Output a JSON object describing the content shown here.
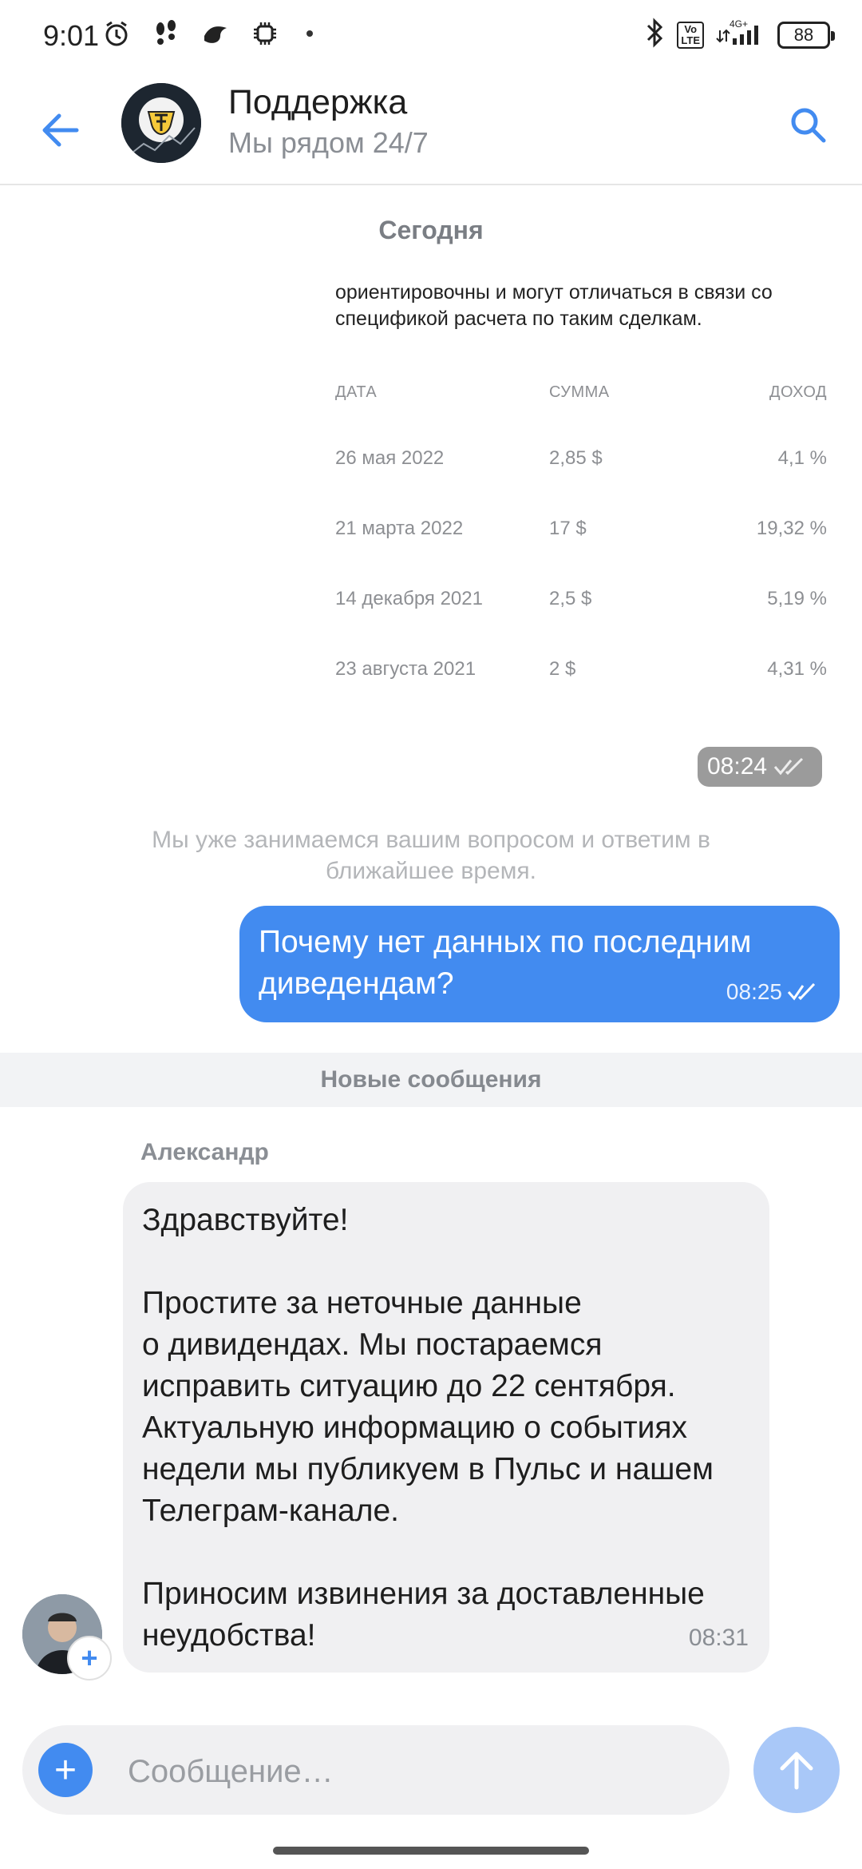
{
  "status_bar": {
    "time": "9:01",
    "volte": "Vo\nLTE",
    "network": "4G+",
    "battery": "88"
  },
  "header": {
    "title": "Поддержка",
    "subtitle": "Мы рядом 24/7"
  },
  "chat": {
    "date_label": "Сегодня",
    "dividends": {
      "text": "ориентировочны и могут отличаться в связи со спецификой расчета по таким сделкам.",
      "headers": [
        "ДАТА",
        "СУММА",
        "ДОХОД"
      ],
      "rows": [
        [
          "26 мая 2022",
          "2,85 $",
          "4,1 %"
        ],
        [
          "21 марта 2022",
          "17 $",
          "19,32 %"
        ],
        [
          "14 декабря 2021",
          "2,5 $",
          "5,19 %"
        ],
        [
          "23 августа 2021",
          "2 $",
          "4,31 %"
        ]
      ],
      "time": "08:24"
    },
    "system_message": "Мы уже занимаемся вашим вопросом и ответим в ближайшее время.",
    "outgoing": {
      "text": "Почему нет данных по последним диведендам?",
      "time": "08:25"
    },
    "new_messages_label": "Новые сообщения",
    "incoming": {
      "sender": "Александр",
      "text": "Здравствуйте!\n\nПростите за неточные данные\nо дивидендах. Мы постараемся исправить ситуацию до 22 сентября. Актуальную информацию о событиях недели мы публикуем в Пульс и нашем Телеграм-канале.\n\nПриносим извинения за доставленные неудобства!",
      "time": "08:31"
    }
  },
  "composer": {
    "placeholder": "Сообщение…"
  },
  "colors": {
    "accent": "#428bf0",
    "send_disabled": "#a9c8f8",
    "bubble_in": "#f0f0f2"
  }
}
